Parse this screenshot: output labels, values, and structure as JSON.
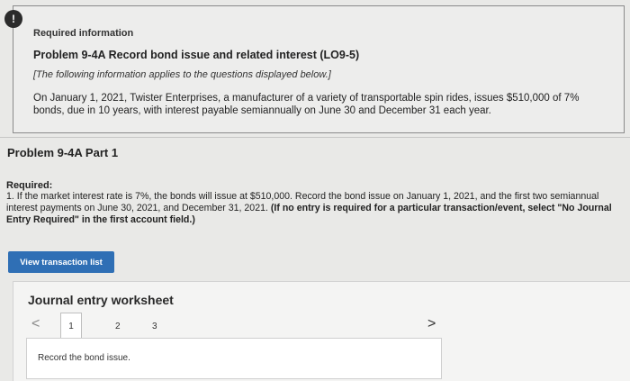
{
  "info": {
    "alert_icon": "!",
    "heading": "Required information",
    "problem_title": "Problem 9-4A Record bond issue and related interest (LO9-5)",
    "note": "[The following information applies to the questions displayed below.]",
    "body": "On January 1, 2021, Twister Enterprises, a manufacturer of a variety of transportable spin rides, issues $510,000 of 7% bonds, due in 10 years, with interest payable semiannually on June 30 and December 31 each year."
  },
  "part": {
    "title": "Problem 9-4A Part 1"
  },
  "required": {
    "label": "Required:",
    "text": "1. If the market interest rate is 7%, the bonds will issue at $510,000. Record the bond issue on January 1, 2021, and the first two semiannual interest payments on June 30, 2021, and December 31, 2021.",
    "bold_text": "(If no entry is required for a particular transaction/event, select \"No Journal Entry Required\" in the first account field.)"
  },
  "buttons": {
    "view_transactions": "View transaction list"
  },
  "worksheet": {
    "title": "Journal entry worksheet",
    "prev_icon": "<",
    "next_icon": ">",
    "pages": [
      "1",
      "2",
      "3"
    ],
    "active_page": 1,
    "instruction": "Record the bond issue."
  }
}
